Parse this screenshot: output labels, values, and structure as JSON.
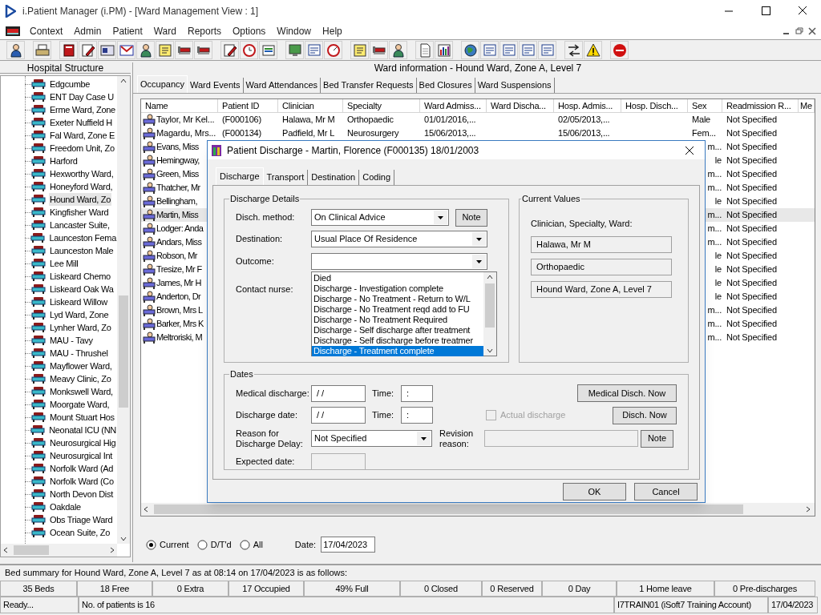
{
  "window": {
    "title": "i.Patient Manager (i.PM) - [Ward Management View : 1]"
  },
  "menu": [
    "Context",
    "Admin",
    "Patient",
    "Ward",
    "Reports",
    "Options",
    "Window",
    "Help"
  ],
  "tree": {
    "title": "Hospital Structure",
    "items": [
      {
        "label": "Edgcumbe",
        "selected": false
      },
      {
        "label": "ENT Day Case U",
        "selected": false
      },
      {
        "label": "Erme Ward, Zone",
        "selected": false
      },
      {
        "label": "Exeter Nuffield H",
        "selected": false
      },
      {
        "label": "Fal Ward, Zone E",
        "selected": false
      },
      {
        "label": "Freedom Unit, Zo",
        "selected": false
      },
      {
        "label": "Harford",
        "selected": false
      },
      {
        "label": "Hexworthy Ward,",
        "selected": false
      },
      {
        "label": "Honeyford Ward,",
        "selected": false
      },
      {
        "label": "Hound Ward, Zo",
        "selected": true
      },
      {
        "label": "Kingfisher Ward",
        "selected": false
      },
      {
        "label": "Lancaster Suite,",
        "selected": false
      },
      {
        "label": "Launceston Fema",
        "selected": false
      },
      {
        "label": "Launceston Male",
        "selected": false
      },
      {
        "label": "Lee Mill",
        "selected": false
      },
      {
        "label": "Liskeard Chemo",
        "selected": false
      },
      {
        "label": "Liskeard Oak Wa",
        "selected": false
      },
      {
        "label": "Liskeard Willow",
        "selected": false
      },
      {
        "label": "Lyd Ward, Zone",
        "selected": false
      },
      {
        "label": "Lynher Ward, Zo",
        "selected": false
      },
      {
        "label": "MAU - Tavy",
        "selected": false
      },
      {
        "label": "MAU - Thrushel",
        "selected": false
      },
      {
        "label": "Mayflower Ward,",
        "selected": false
      },
      {
        "label": "Meavy Clinic, Zo",
        "selected": false
      },
      {
        "label": "Monkswell Ward,",
        "selected": false
      },
      {
        "label": "Moorgate Ward,",
        "selected": false
      },
      {
        "label": "Mount Stuart Hos",
        "selected": false
      },
      {
        "label": "Neonatal ICU (NN",
        "selected": false
      },
      {
        "label": "Neurosurgical Hig",
        "selected": false
      },
      {
        "label": "Neurosurgical Int",
        "selected": false
      },
      {
        "label": "Norfolk Ward (Ad",
        "selected": false
      },
      {
        "label": "Norfolk Ward (Co",
        "selected": false
      },
      {
        "label": "North Devon Dist",
        "selected": false
      },
      {
        "label": "Oakdale",
        "selected": false
      },
      {
        "label": "Obs Triage Ward",
        "selected": false
      },
      {
        "label": "Ocean Suite, Zo",
        "selected": false
      }
    ]
  },
  "ward_info": "Ward information - Hound Ward, Zone A, Level 7",
  "tabs": [
    {
      "label": "Occupancy",
      "selected": true
    },
    {
      "label": "Ward Events",
      "selected": false
    },
    {
      "label": "Ward Attendances",
      "selected": false
    },
    {
      "label": "Bed Transfer Requests",
      "selected": false
    },
    {
      "label": "Bed Closures",
      "selected": false
    },
    {
      "label": "Ward Suspensions",
      "selected": false
    }
  ],
  "table": {
    "columns": [
      "Name",
      "Patient ID",
      "Clinician",
      "Specialty",
      "Ward Admiss...",
      "Ward Discha...",
      "Hosp. Admis...",
      "Hosp. Disch...",
      "Sex",
      "Readmission R...",
      "Me"
    ],
    "rows": [
      {
        "name": "Taylor, Mr Kel...",
        "patient_id": "(F000106)",
        "clinician": "Halawa, Mr M",
        "specialty": "Orthopaedic",
        "ward_admission": "01/01/2016,...",
        "hosp_admission": "02/05/2013,...",
        "sex": "Male",
        "readmission": "Not Specified",
        "selected": false
      },
      {
        "name": "Magardu, Mrs...",
        "patient_id": "(F000134)",
        "clinician": "Padfield, Mr L",
        "specialty": "Neurosurgery",
        "ward_admission": "15/06/2013,...",
        "hosp_admission": "15/06/2013,...",
        "sex": "Fem...",
        "readmission": "Not Specified",
        "selected": false
      },
      {
        "name": "Evans, Miss",
        "sex": "m...",
        "readmission": "Not Specified",
        "selected": false
      },
      {
        "name": "Hemingway,",
        "sex": "le",
        "readmission": "Not Specified",
        "selected": false
      },
      {
        "name": "Green, Miss",
        "sex": "m...",
        "readmission": "Not Specified",
        "selected": false
      },
      {
        "name": "Thatcher, Mr",
        "sex": "m...",
        "readmission": "Not Specified",
        "selected": false
      },
      {
        "name": "Bellingham,",
        "sex": "le",
        "readmission": "Not Specified",
        "selected": false
      },
      {
        "name": "Martin, Miss",
        "sex": "m...",
        "readmission": "Not Specified",
        "selected": true
      },
      {
        "name": "Lodger: Anda",
        "sex": "m...",
        "readmission": "Not Specified",
        "selected": false
      },
      {
        "name": "Andars, Miss",
        "sex": "m...",
        "readmission": "Not Specified",
        "selected": false
      },
      {
        "name": "Robson, Mr",
        "sex": "le",
        "readmission": "Not Specified",
        "selected": false
      },
      {
        "name": "Tresize, Mr F",
        "sex": "le",
        "readmission": "Not Specified",
        "selected": false
      },
      {
        "name": "James, Mr H",
        "sex": "le",
        "readmission": "Not Specified",
        "selected": false
      },
      {
        "name": "Anderton, Dr",
        "sex": "le",
        "readmission": "Not Specified",
        "selected": false
      },
      {
        "name": "Brown, Mrs L",
        "sex": "m...",
        "readmission": "Not Specified",
        "selected": false
      },
      {
        "name": "Barker, Mrs K",
        "sex": "m...",
        "readmission": "Not Specified",
        "selected": false
      },
      {
        "name": "Meltroriski, M",
        "sex": "m...",
        "readmission": "Not Specified",
        "selected": false
      }
    ]
  },
  "filter": [
    {
      "label": "Current",
      "selected": true
    },
    {
      "label": "D/T'd",
      "selected": false
    },
    {
      "label": "All",
      "selected": false
    }
  ],
  "date": {
    "label": "Date:",
    "value": "17/04/2023"
  },
  "bed_summary": "Bed summary for Hound Ward, Zone A, Level 7 as at 08:14 on 17/04/2023 is as follows:",
  "stats": [
    "35 Beds",
    "18 Free",
    "0 Extra",
    "17 Occupied",
    "49% Full",
    "0 Closed",
    "0 Reserved",
    "0 Day",
    "1 Home leave",
    "0 Pre-discharges"
  ],
  "status_bar": [
    "Ready...",
    "No. of patients is 16",
    "I7TRAIN01 (iSoft7 Training Account)",
    "17/04/2023"
  ],
  "dialog": {
    "title": "Patient Discharge - Martin, Florence (F000135) 18/01/2003",
    "tabs": [
      {
        "label": "Discharge",
        "selected": true
      },
      {
        "label": "Transport",
        "selected": false
      },
      {
        "label": "Destination",
        "selected": false
      },
      {
        "label": "Coding",
        "selected": false
      }
    ],
    "discharge_details": {
      "title": "Discharge Details",
      "disch_method": {
        "label": "Disch. method:",
        "value": "On Clinical Advice"
      },
      "note_button": "Note",
      "destination": {
        "label": "Destination:",
        "value": "Usual Place Of Residence"
      },
      "outcome": {
        "label": "Outcome:",
        "options": [
          {
            "label": "Died",
            "selected": false
          },
          {
            "label": "Discharge - Investigation complete",
            "selected": false
          },
          {
            "label": "Discharge - No Treatment - Return to W/L",
            "selected": false
          },
          {
            "label": "Discharge - No Treatment reqd add to FU",
            "selected": false
          },
          {
            "label": "Discharge - No Treatment Required",
            "selected": false
          },
          {
            "label": "Discharge - Self discharge after treatment",
            "selected": false
          },
          {
            "label": "Discharge - Self discharge before treatmer",
            "selected": false
          },
          {
            "label": "Discharge - Treatment complete",
            "selected": true
          }
        ]
      },
      "contact_nurse": {
        "label": "Contact nurse:"
      }
    },
    "current_values": {
      "title": "Current Values",
      "label": "Clinician, Specialty, Ward:",
      "values": [
        "Halawa, Mr M",
        "Orthopaedic",
        "Hound Ward, Zone A, Level 7"
      ]
    },
    "dates": {
      "title": "Dates",
      "medical_discharge": {
        "label": "Medical discharge:",
        "value": "/ /"
      },
      "medical_time": {
        "label": "Time:",
        "value": ":"
      },
      "medical_now_button": "Medical Disch. Now",
      "discharge_date": {
        "label": "Discharge date:",
        "value": "/ /"
      },
      "discharge_time": {
        "label": "Time:",
        "value": ":"
      },
      "actual_discharge": {
        "label": "Actual discharge",
        "checked": false,
        "disabled": true
      },
      "disch_now_button": "Disch. Now",
      "delay": {
        "label": "Reason for Discharge Delay:",
        "value": "Not Specified"
      },
      "revision": {
        "label": "Revision reason:"
      },
      "note_button": "Note",
      "expected": {
        "label": "Expected date:"
      }
    },
    "buttons": [
      "OK",
      "Cancel"
    ]
  }
}
